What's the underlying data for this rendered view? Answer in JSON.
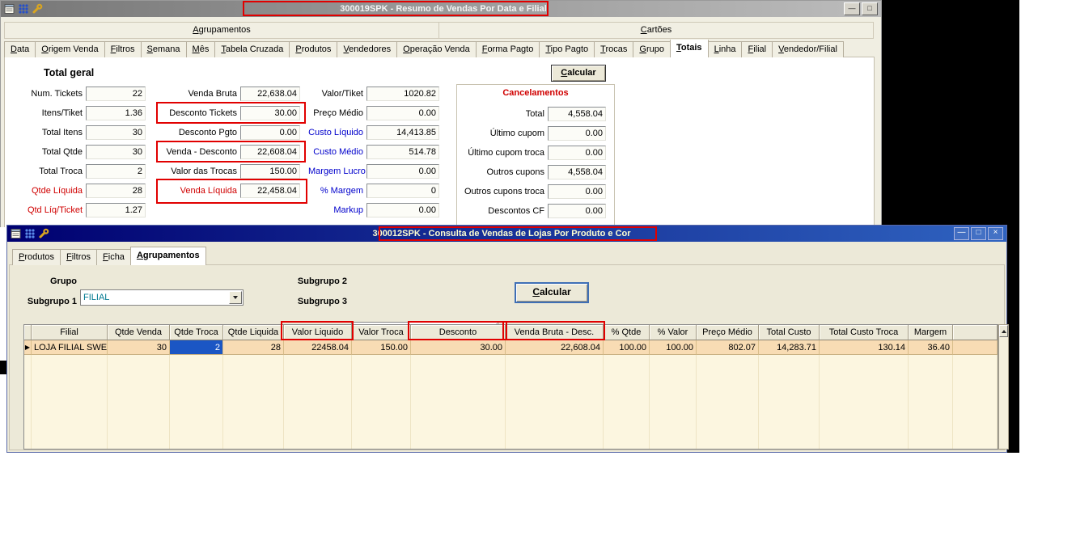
{
  "colors": {
    "annotation_red": "#e10000",
    "window1_titlebar": "#8a8a8a",
    "window2_titlebar": "#000080",
    "red_label": "#d00000",
    "blue_label": "#0000cc",
    "row_highlight": "#f8dcb4",
    "selected_cell_blue": "#1b56c4",
    "combo_value_teal": "#007890"
  },
  "window1": {
    "title": "300019SPK - Resumo de Vendas Por Data e Filial",
    "controls": {
      "minimize": "—",
      "maximize": "□"
    },
    "titlebar_icons": [
      "report-icon",
      "components-icon",
      "wrench-icon"
    ],
    "group_tabs": [
      "Agrupamentos",
      "Cartões"
    ],
    "tabs": [
      "Data",
      "Origem Venda",
      "Filtros",
      "Semana",
      "Mês",
      "Tabela Cruzada",
      "Produtos",
      "Vendedores",
      "Operação Venda",
      "Forma Pagto",
      "Tipo Pagto",
      "Trocas",
      "Grupo",
      "Totais",
      "Linha",
      "Filial",
      "Vendedor/Filial"
    ],
    "active_tab": "Totais",
    "heading": "Total geral",
    "calc_button": "Calcular",
    "left_fields": [
      {
        "label": "Num. Tickets",
        "value": "22"
      },
      {
        "label": "Itens/Tiket",
        "value": "1.36"
      },
      {
        "label": "Total Itens",
        "value": "30"
      },
      {
        "label": "Total Qtde",
        "value": "30"
      },
      {
        "label": "Total Troca",
        "value": "2"
      },
      {
        "label": "Qtde Líquida",
        "value": "28",
        "label_color": "red"
      },
      {
        "label": "Qtd Líq/Ticket",
        "value": "1.27",
        "label_color": "red"
      }
    ],
    "mid_fields": [
      {
        "label": "Venda Bruta",
        "value": "22,638.04"
      },
      {
        "label": "Desconto Tickets",
        "value": "30.00"
      },
      {
        "label": "Desconto Pgto",
        "value": "0.00"
      },
      {
        "label": "Venda - Desconto",
        "value": "22,608.04"
      },
      {
        "label": "Valor das Trocas",
        "value": "150.00"
      },
      {
        "label": "Venda Líquida",
        "value": "22,458.04",
        "label_color": "red"
      }
    ],
    "right_fields": [
      {
        "label": "Valor/Tiket",
        "value": "1020.82"
      },
      {
        "label": "Preço Médio",
        "value": "0.00"
      },
      {
        "label": "Custo Líquido",
        "value": "14,413.85",
        "label_color": "blue"
      },
      {
        "label": "Custo Médio",
        "value": "514.78",
        "label_color": "blue"
      },
      {
        "label": "Margem Lucro",
        "value": "0.00",
        "label_color": "blue"
      },
      {
        "label": "% Margem",
        "value": "0",
        "label_color": "blue"
      },
      {
        "label": "Markup",
        "value": "0.00",
        "label_color": "blue"
      }
    ],
    "cancel": {
      "title": "Cancelamentos",
      "rows": [
        {
          "label": "Total",
          "value": "4,558.04"
        },
        {
          "label": "Último cupom",
          "value": "0.00"
        },
        {
          "label": "Último cupom troca",
          "value": "0.00"
        },
        {
          "label": "Outros cupons",
          "value": "4,558.04"
        },
        {
          "label": "Outros cupons troca",
          "value": "0.00"
        },
        {
          "label": "Descontos CF",
          "value": "0.00"
        }
      ]
    }
  },
  "window2": {
    "title": "300012SPK - Consulta de Vendas de Lojas Por Produto e Cor",
    "controls": {
      "minimize": "—",
      "maximize": "□",
      "close": "×"
    },
    "titlebar_icons": [
      "report-icon",
      "components-icon",
      "wrench-icon"
    ],
    "tabs": [
      "Produtos",
      "Filtros",
      "Ficha",
      "Agrupamentos"
    ],
    "active_tab": "Agrupamentos",
    "form": {
      "grupo_label": "Grupo",
      "grupo_value": "FILIAL",
      "subgrupo1_label": "Subgrupo 1",
      "subgrupo1_value": "",
      "subgrupo2_label": "Subgrupo 2",
      "subgrupo2_value": "",
      "subgrupo3_label": "Subgrupo 3",
      "subgrupo3_value": "",
      "calc_button": "Calcular"
    },
    "table": {
      "columns": [
        "Filial",
        "Qtde Venda",
        "Qtde Troca",
        "Qtde Liquida",
        "Valor Liquido",
        "Valor Troca",
        "Desconto",
        "Venda Bruta - Desc.",
        "% Qtde",
        "% Valor",
        "Preço Médio",
        "Total Custo",
        "Total Custo Troca",
        "Margem"
      ],
      "row": [
        "LOJA FILIAL SWEDA",
        "30",
        "2",
        "28",
        "22458.04",
        "150.00",
        "30.00",
        "22,608.04",
        "100.00",
        "100.00",
        "802.07",
        "14,283.71",
        "130.14",
        "36.40"
      ],
      "selected_column": "Qtde Troca",
      "marker_glyph": "▶"
    }
  }
}
